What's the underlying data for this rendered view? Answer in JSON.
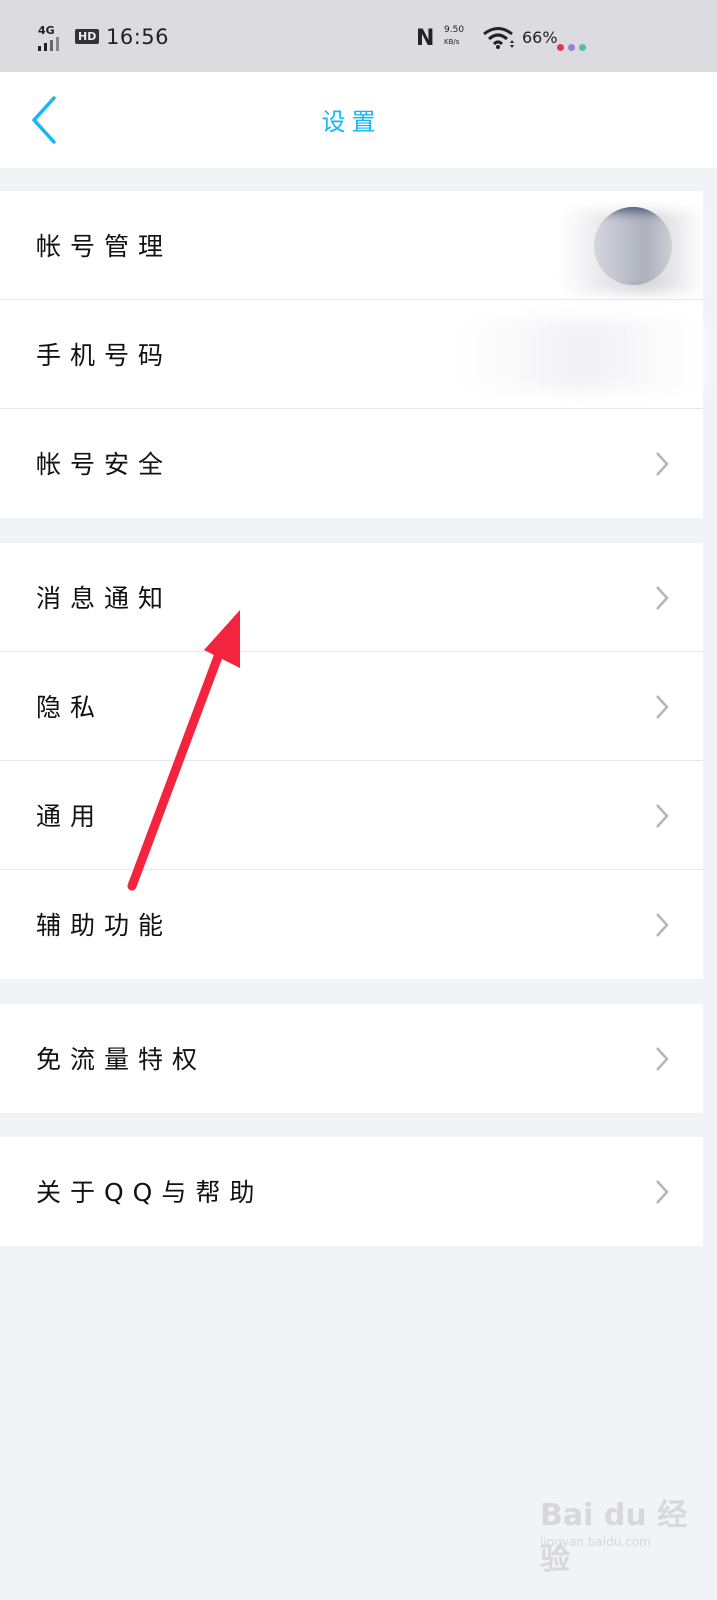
{
  "status_bar": {
    "network": "4G",
    "hd": "HD",
    "time": "16:56",
    "speed_value": "9.50",
    "speed_unit": "KB/s",
    "battery": "66%"
  },
  "nav": {
    "title": "设置",
    "accent_color": "#12b7f5"
  },
  "groups": [
    {
      "items": [
        {
          "label": "帐号管理",
          "has_avatar": true
        },
        {
          "label": "手机号码"
        },
        {
          "label": "帐号安全",
          "has_chevron": true
        }
      ]
    },
    {
      "items": [
        {
          "label": "消息通知",
          "has_chevron": true
        },
        {
          "label": "隐私",
          "has_chevron": true
        },
        {
          "label": "通用",
          "has_chevron": true
        },
        {
          "label": "辅助功能",
          "has_chevron": true
        }
      ]
    },
    {
      "items": [
        {
          "label": "免流量特权",
          "has_chevron": true
        }
      ]
    },
    {
      "items": [
        {
          "label": "关于QQ与帮助",
          "has_chevron": true
        }
      ]
    }
  ],
  "watermark": {
    "brand": "Bai du 经验",
    "url": "jingyan.baidu.com"
  },
  "annotation_color": "#f5243e"
}
